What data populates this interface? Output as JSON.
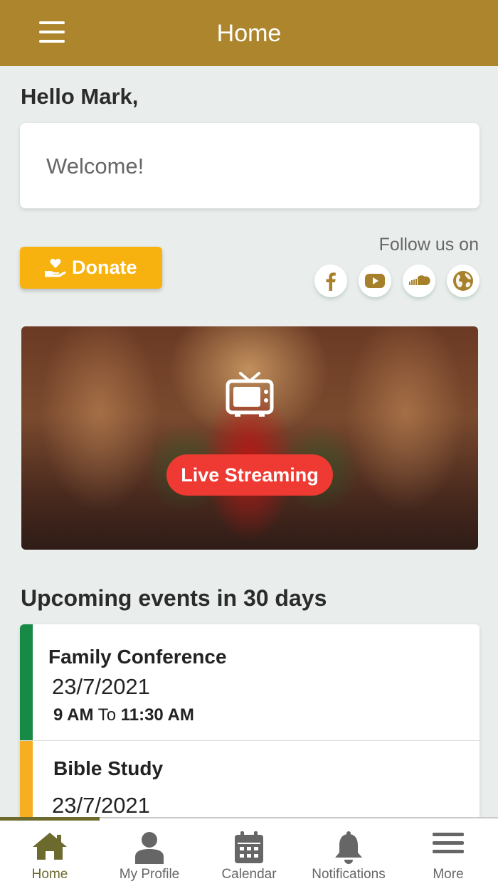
{
  "header": {
    "title": "Home",
    "menu_icon": "hamburger-menu-icon"
  },
  "greeting": "Hello Mark,",
  "welcome": {
    "text": "Welcome!"
  },
  "donate": {
    "label": "Donate",
    "icon": "heart-hand-icon",
    "color": "#f7b20f"
  },
  "follow": {
    "label": "Follow us on",
    "icons": [
      "facebook-icon",
      "youtube-icon",
      "soundcloud-icon",
      "globe-icon"
    ],
    "icon_color": "#a6802a"
  },
  "live": {
    "label": "Live Streaming",
    "icon": "tv-icon",
    "button_color": "#ee3a32"
  },
  "events": {
    "title": "Upcoming events in 30 days",
    "items": [
      {
        "name": "Family Conference",
        "date": "23/7/2021",
        "start": "9 AM",
        "to": "To",
        "end": "11:30 AM",
        "color": "#178a45"
      },
      {
        "name": "Bible Study",
        "date": "23/7/2021",
        "color": "#f6ae22"
      }
    ]
  },
  "nav": {
    "items": [
      {
        "label": "Home",
        "icon": "home-icon",
        "active": true
      },
      {
        "label": "My Profile",
        "icon": "person-icon"
      },
      {
        "label": "Calendar",
        "icon": "calendar-icon"
      },
      {
        "label": "Notifications",
        "icon": "bell-icon"
      },
      {
        "label": "More",
        "icon": "more-menu-icon"
      }
    ],
    "active_color": "#6d6a2e",
    "theme_color": "#ad852c"
  }
}
